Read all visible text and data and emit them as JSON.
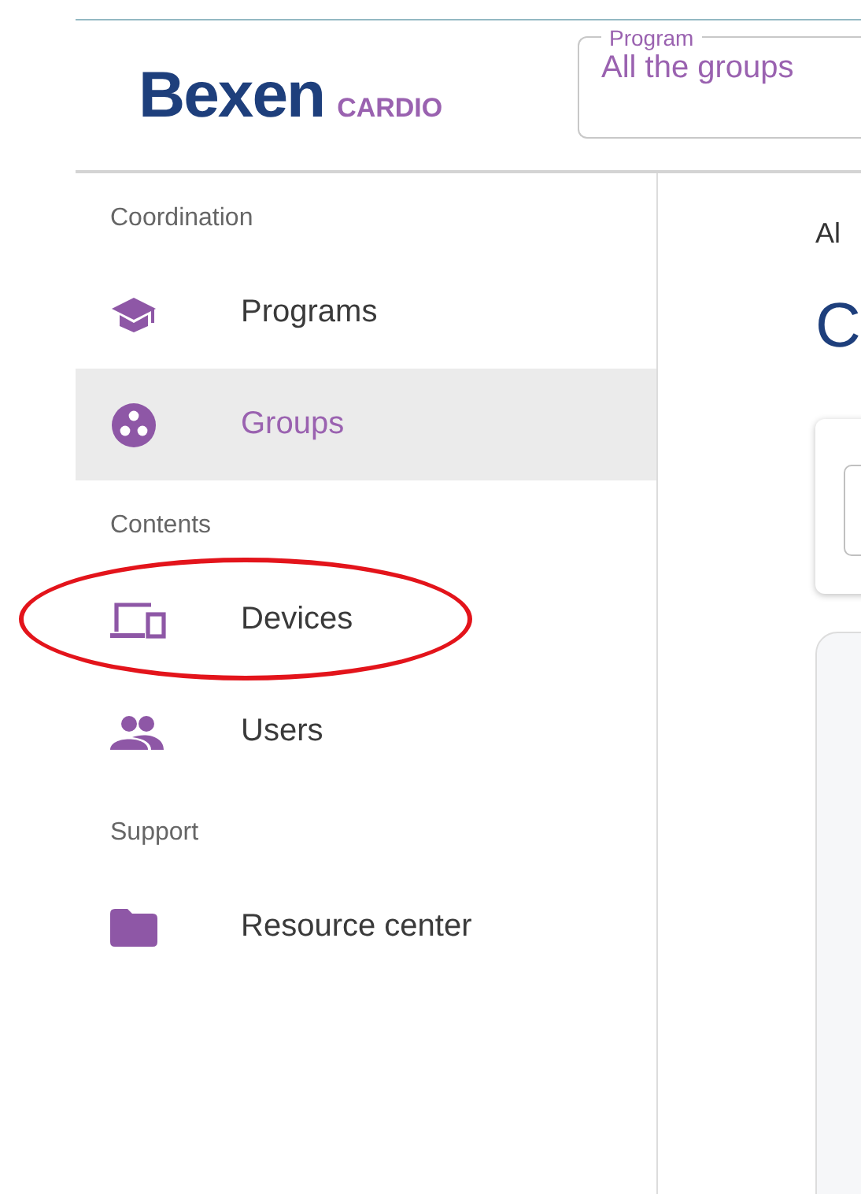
{
  "header": {
    "logo": {
      "name": "Bexen",
      "product": "CARDIO"
    },
    "program_select": {
      "label": "Program",
      "value": "All the groups"
    }
  },
  "sidebar": {
    "sections": [
      {
        "title": "Coordination",
        "items": [
          {
            "label": "Programs",
            "kind": "cap",
            "selected": false,
            "circled": false
          },
          {
            "label": "Groups",
            "kind": "groups",
            "selected": true,
            "circled": false
          }
        ]
      },
      {
        "title": "Contents",
        "items": [
          {
            "label": "Devices",
            "kind": "devices",
            "selected": false,
            "circled": true
          },
          {
            "label": "Users",
            "kind": "users",
            "selected": false,
            "circled": false
          }
        ]
      },
      {
        "title": "Support",
        "items": [
          {
            "label": "Resource center",
            "kind": "folder",
            "selected": false,
            "circled": false
          }
        ]
      }
    ]
  },
  "main": {
    "breadcrumb": "Al",
    "heading": "C"
  }
}
